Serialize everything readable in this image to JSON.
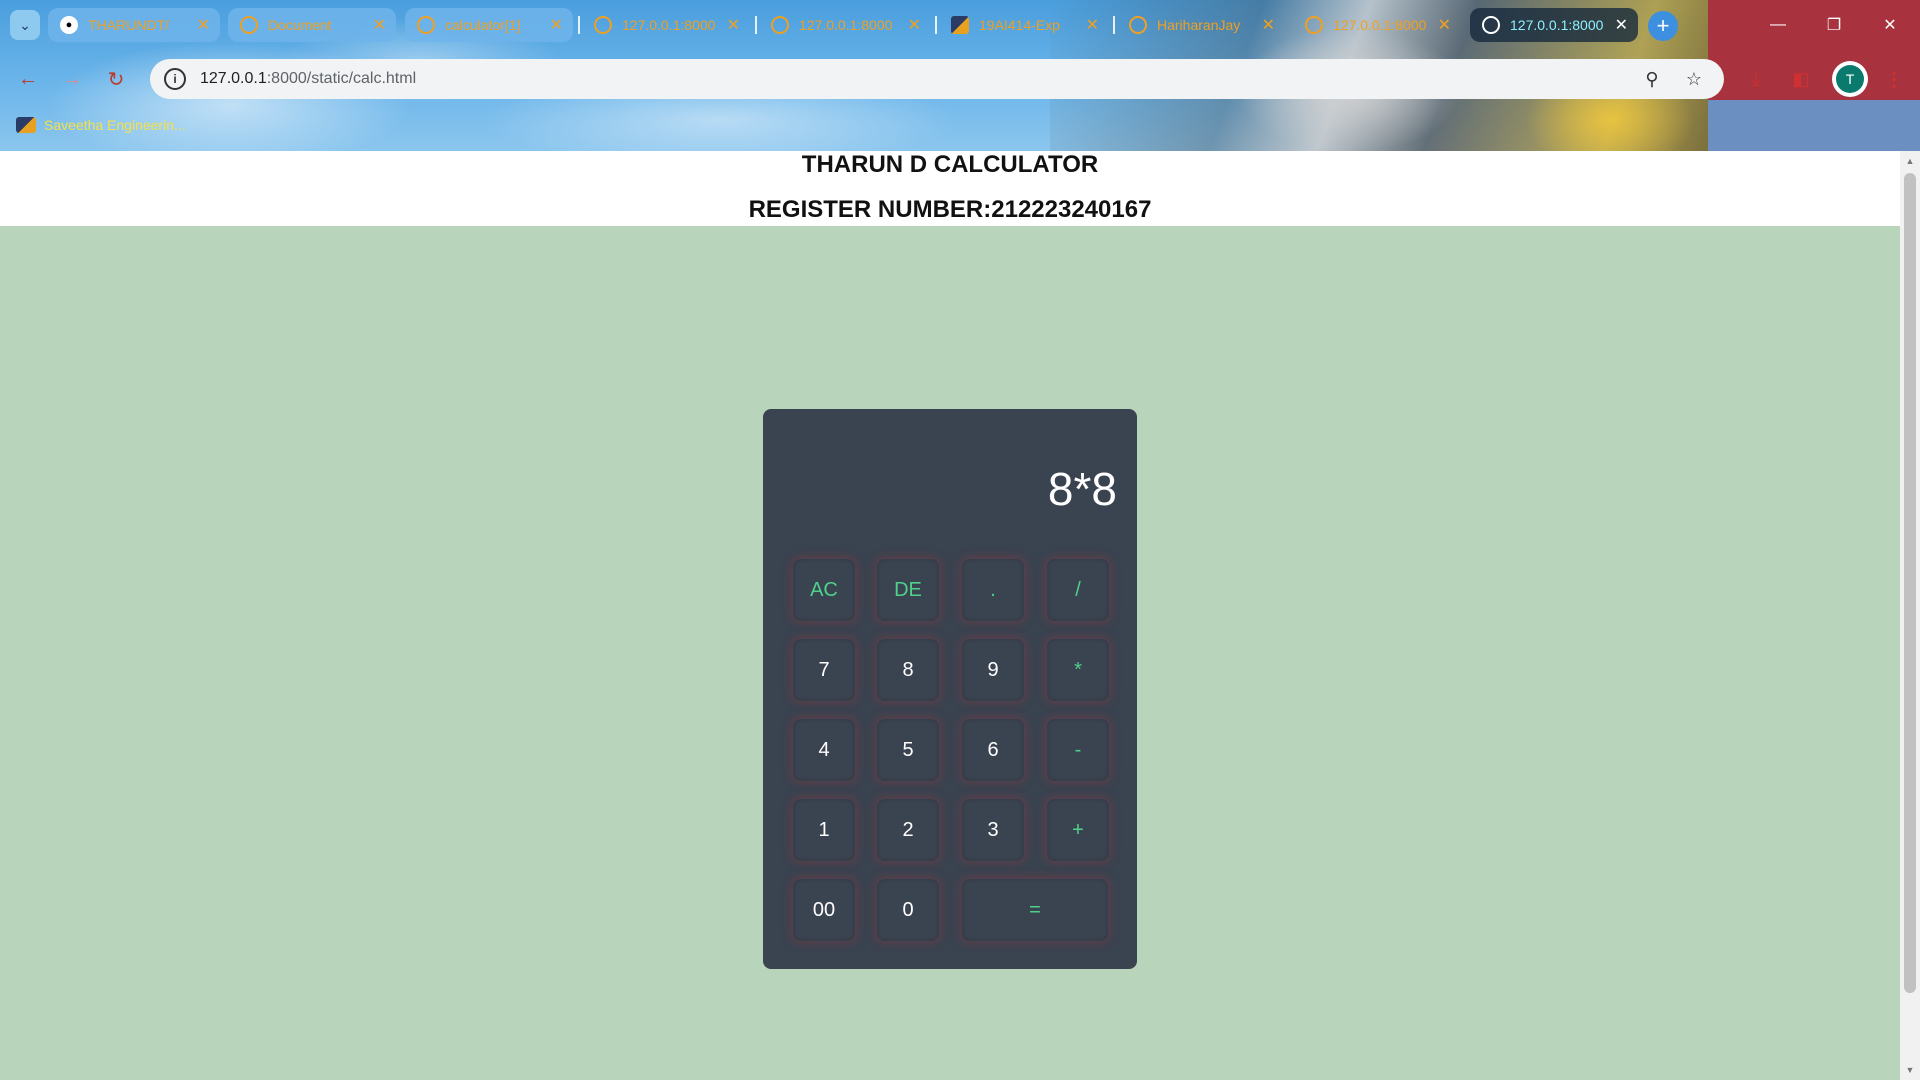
{
  "browser": {
    "tabs": [
      {
        "title": "THARUNDT/",
        "favicon": "github-icon"
      },
      {
        "title": "Document",
        "favicon": "globe-icon"
      },
      {
        "title": "calculator[1]",
        "favicon": "globe-icon"
      },
      {
        "title": "127.0.0.1:8000",
        "favicon": "globe-icon"
      },
      {
        "title": "127.0.0.1:8000",
        "favicon": "globe-icon"
      },
      {
        "title": "19AI414-Exp",
        "favicon": "saveetha-icon"
      },
      {
        "title": "HariharanJay",
        "favicon": "globe-icon"
      },
      {
        "title": "127.0.0.1:8000",
        "favicon": "globe-icon"
      },
      {
        "title": "127.0.0.1:8000",
        "favicon": "globe-icon"
      }
    ],
    "url_host": "127.0.0.1",
    "url_path": ":8000/static/calc.html",
    "profile_initial": "T",
    "bookmark": "Saveetha Engineerin..."
  },
  "page": {
    "title": "THARUN D CALCULATOR",
    "register": "REGISTER NUMBER:212223240167"
  },
  "calculator": {
    "display": "8*8",
    "rows": [
      [
        "AC",
        "DE",
        ".",
        "/"
      ],
      [
        "7",
        "8",
        "9",
        "*"
      ],
      [
        "4",
        "5",
        "6",
        "-"
      ],
      [
        "1",
        "2",
        "3",
        "+"
      ],
      [
        "00",
        "0",
        "="
      ]
    ]
  },
  "colors": {
    "page_bg": "#b8d5bb",
    "calc_bg": "#3a4350",
    "operator": "#4fd18b",
    "digit": "#ffffff"
  }
}
